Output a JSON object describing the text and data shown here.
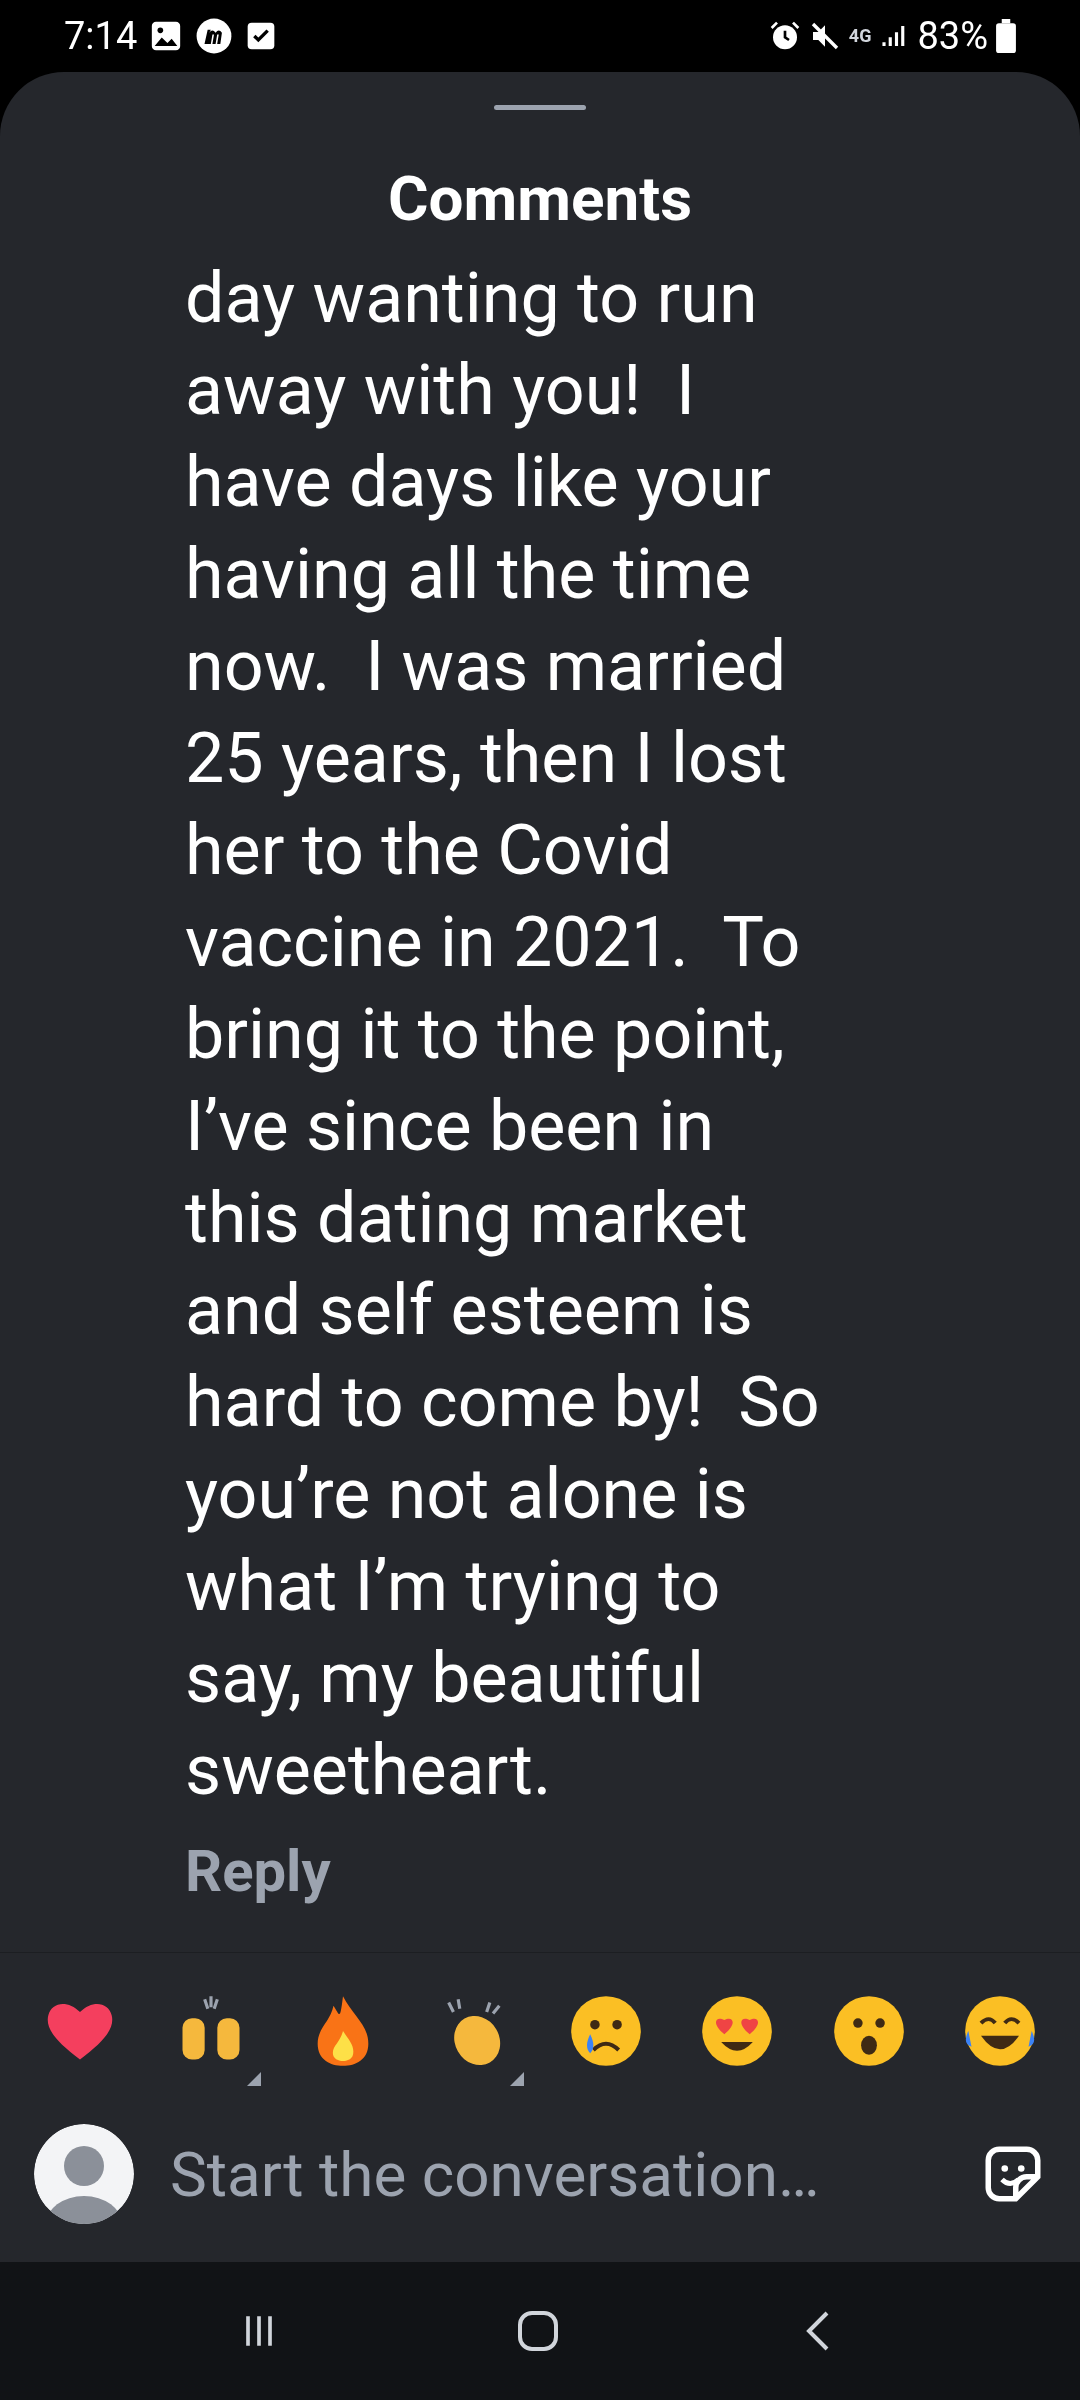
{
  "status_bar": {
    "time": "7:14",
    "network": "4G",
    "battery": "83%"
  },
  "sheet": {
    "title": "Comments"
  },
  "comment": {
    "lines": [
      "day wanting to run",
      "away with you!  I",
      "have days like your",
      "having all the time",
      "now.  I was married",
      "25 years, then I lost",
      "her to the Covid",
      "vaccine in 2021.  To",
      "bring it to the point,",
      "I’ve since been in",
      "this dating market",
      "and self esteem is",
      "hard to come by!  So",
      "you’re not alone is",
      "what I’m trying to",
      "say, my beautiful",
      "sweetheart."
    ],
    "reply": "Reply"
  },
  "reactions": [
    {
      "kind": "heart",
      "more": false
    },
    {
      "kind": "raised-hands",
      "more": true
    },
    {
      "kind": "fire",
      "more": false
    },
    {
      "kind": "clap",
      "more": true
    },
    {
      "kind": "sad",
      "more": false
    },
    {
      "kind": "heart-eyes",
      "more": false
    },
    {
      "kind": "wow",
      "more": false
    },
    {
      "kind": "laugh",
      "more": false
    }
  ],
  "composer": {
    "placeholder": "Start the conversation…"
  }
}
